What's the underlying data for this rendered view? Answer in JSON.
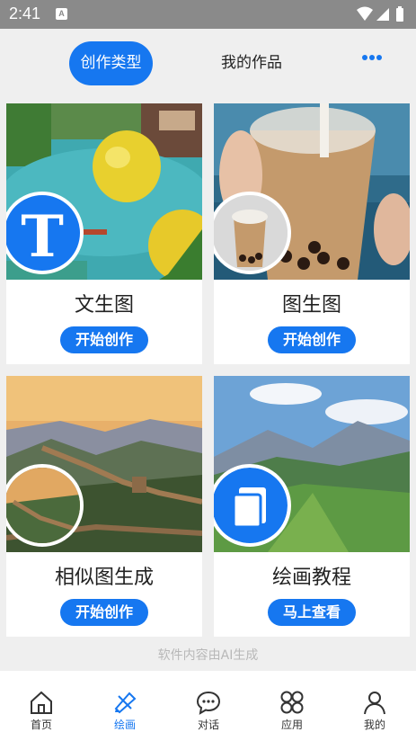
{
  "status_bar": {
    "time": "2:41",
    "notification_letter": "A"
  },
  "tabs": {
    "active": "创作类型",
    "other": "我的作品"
  },
  "cards": [
    {
      "title": "文生图",
      "button": "开始创作",
      "badge_letter": "T"
    },
    {
      "title": "图生图",
      "button": "开始创作"
    },
    {
      "title": "相似图生成",
      "button": "开始创作"
    },
    {
      "title": "绘画教程",
      "button": "马上查看"
    }
  ],
  "footer_note": "软件内容由AI生成",
  "nav": [
    {
      "label": "首页",
      "icon": "home-icon"
    },
    {
      "label": "绘画",
      "icon": "paint-icon",
      "active": true
    },
    {
      "label": "对话",
      "icon": "chat-icon"
    },
    {
      "label": "应用",
      "icon": "apps-icon"
    },
    {
      "label": "我的",
      "icon": "profile-icon"
    }
  ],
  "colors": {
    "accent": "#1677f0",
    "status_bar": "#8a8a8a",
    "background": "#efefef"
  }
}
